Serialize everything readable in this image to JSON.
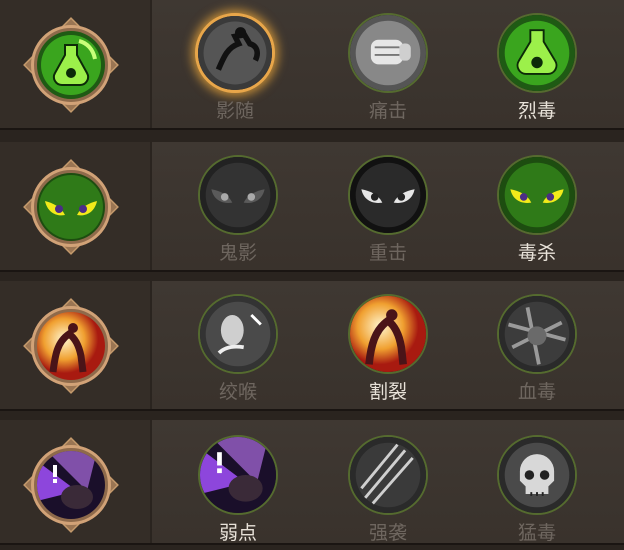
{
  "rows": [
    {
      "main_icon": "poison-bottle-icon",
      "skills": [
        {
          "label": "影随",
          "icon": "shadow-figure-icon",
          "active": false,
          "selected": true
        },
        {
          "label": "痛击",
          "icon": "fist-icon",
          "active": false,
          "selected": false
        },
        {
          "label": "烈毒",
          "icon": "poison-bottle-icon",
          "active": true,
          "selected": false
        }
      ]
    },
    {
      "main_icon": "glowing-eyes-icon",
      "skills": [
        {
          "label": "鬼影",
          "icon": "ghost-eyes-icon",
          "active": false,
          "selected": false
        },
        {
          "label": "重击",
          "icon": "owl-eyes-icon",
          "active": false,
          "selected": false
        },
        {
          "label": "毒杀",
          "icon": "glowing-eyes-icon",
          "active": true,
          "selected": false
        }
      ]
    },
    {
      "main_icon": "bleeding-figure-icon",
      "skills": [
        {
          "label": "绞喉",
          "icon": "strangle-icon",
          "active": false,
          "selected": false
        },
        {
          "label": "割裂",
          "icon": "bleeding-figure-icon",
          "active": true,
          "selected": false
        },
        {
          "label": "血毒",
          "icon": "blood-poison-icon",
          "active": false,
          "selected": false
        }
      ]
    },
    {
      "main_icon": "weak-point-icon",
      "skills": [
        {
          "label": "弱点",
          "icon": "weak-point-icon",
          "active": true,
          "selected": false
        },
        {
          "label": "强袭",
          "icon": "slash-icon",
          "active": false,
          "selected": false
        },
        {
          "label": "猛毒",
          "icon": "skull-icon",
          "active": false,
          "selected": false
        }
      ]
    }
  ],
  "colors": {
    "active_text": "#e8e2d9",
    "inactive_text": "#6e665f",
    "selected_glow": "#e8a64a",
    "frame": "#9a7553"
  }
}
